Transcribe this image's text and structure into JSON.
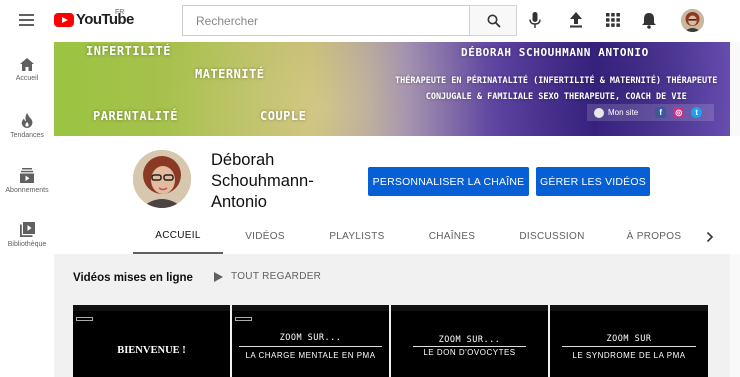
{
  "topbar": {
    "logo_text": "YouTube",
    "logo_country": "FR",
    "search_placeholder": "Rechercher",
    "icons": [
      "menu-icon",
      "search-icon",
      "microphone-icon",
      "upload-icon",
      "apps-icon",
      "bell-icon",
      "account-avatar"
    ]
  },
  "sidebar": {
    "items": [
      {
        "label": "Accueil",
        "icon": "home-icon"
      },
      {
        "label": "Tendances",
        "icon": "flame-icon"
      },
      {
        "label": "Abonnements",
        "icon": "subscriptions-icon"
      },
      {
        "label": "Bibliothèque",
        "icon": "library-icon"
      }
    ]
  },
  "banner": {
    "words": [
      "INFERTILITÉ",
      "MATERNITÉ",
      "PARENTALITÉ",
      "COUPLE"
    ],
    "name": "DÉBORAH SCHOUHMANN ANTONIO",
    "desc_line1": "THÉRAPEUTE EN PÉRINATALITÉ (INFERTILITÉ & MATERNITÉ) THÉRAPEUTE",
    "desc_line2": "CONJUGALE & FAMILIALE SEXO THERAPEUTE, COACH DE VIE",
    "site_label": "Mon site",
    "social": [
      "facebook-icon",
      "instagram-icon",
      "twitter-icon"
    ]
  },
  "channel": {
    "name": "Déborah Schouhmann-Antonio",
    "customize_label": "PERSONNALISER LA CHAÎNE",
    "manage_label": "GÉRER LES VIDÉOS",
    "tabs": [
      "ACCUEIL",
      "VIDÉOS",
      "PLAYLISTS",
      "CHAÎNES",
      "DISCUSSION",
      "À PROPOS"
    ],
    "active_tab": "ACCUEIL"
  },
  "section": {
    "title": "Vidéos mises en ligne",
    "play_all": "TOUT REGARDER",
    "videos": [
      {
        "title_main": "BIENVENUE !",
        "title_sub": ""
      },
      {
        "title_main": "ZOOM SUR...",
        "title_sub": "LA CHARGE MENTALE EN PMA"
      },
      {
        "title_main": "ZOOM SUR...",
        "title_sub": "LE DON D'OVOCYTES"
      },
      {
        "title_main": "ZOOM SUR",
        "title_sub": "LE SYNDROME DE LA PMA"
      }
    ]
  },
  "colors": {
    "accent_blue": "#065fd4",
    "youtube_red": "#ff0000"
  }
}
